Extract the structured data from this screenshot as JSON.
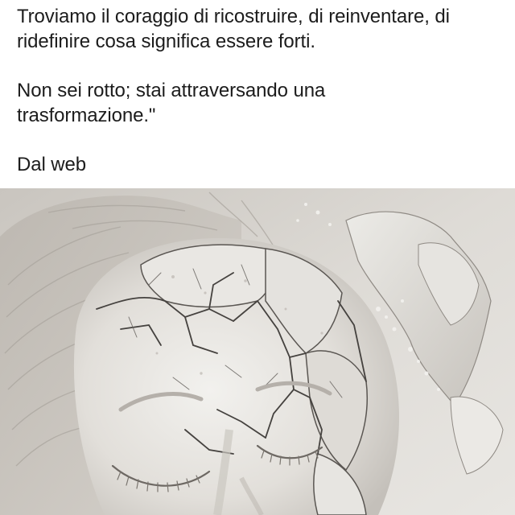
{
  "post": {
    "paragraphs": [
      {
        "lines": [
          "Troviamo il coraggio di ricostruire, di reinventare, di",
          "ridefinire cosa significa essere forti."
        ]
      },
      {
        "lines": [
          "Non sei rotto; stai attraversando una",
          "trasformazione.\""
        ]
      },
      {
        "lines": [
          "Dal web"
        ]
      }
    ]
  },
  "image": {
    "subject": "cracked-plaster-face-sculpture",
    "colors": {
      "background": "#d9d6d1",
      "plaster_light": "#ecebe7",
      "plaster_mid": "#cfccc6",
      "crack": "#4a4744"
    }
  }
}
